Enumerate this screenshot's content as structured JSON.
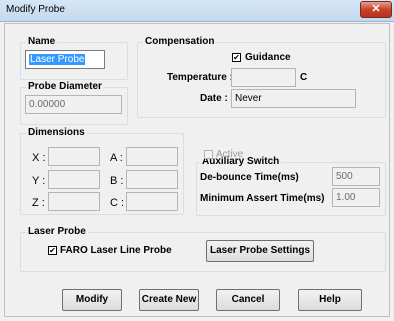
{
  "window": {
    "title": "Modify Probe",
    "close_glyph": "✕"
  },
  "name": {
    "legend": "Name",
    "value": "Laser Probe"
  },
  "probe_diameter": {
    "legend": "Probe Diameter",
    "value": "0.00000"
  },
  "compensation": {
    "legend": "Compensation",
    "guidance_label": "Guidance",
    "guidance_checked": true,
    "temperature_label": "Temperature :",
    "temperature_value": "",
    "temperature_unit": "C",
    "date_label": "Date :",
    "date_value": "Never"
  },
  "dimensions": {
    "legend": "Dimensions",
    "x_label": "X :",
    "x_value": "",
    "y_label": "Y :",
    "y_value": "",
    "z_label": "Z :",
    "z_value": "",
    "a_label": "A :",
    "a_value": "",
    "b_label": "B :",
    "b_value": "",
    "c_label": "C :",
    "c_value": ""
  },
  "aux_switch": {
    "legend": "Auxiliary Switch",
    "active_label": "Active",
    "active_checked": false,
    "debounce_label": "De-bounce Time(ms)",
    "debounce_value": "500",
    "min_assert_label": "Minimum Assert Time(ms)",
    "min_assert_value": "1.00"
  },
  "laser_probe": {
    "legend": "Laser Probe",
    "faro_label": "FARO Laser Line Probe",
    "faro_checked": true,
    "settings_button": "Laser Probe Settings"
  },
  "buttons": {
    "modify": "Modify",
    "create_new": "Create New",
    "cancel": "Cancel",
    "help": "Help"
  },
  "icons": {
    "check_glyph": "✔"
  }
}
